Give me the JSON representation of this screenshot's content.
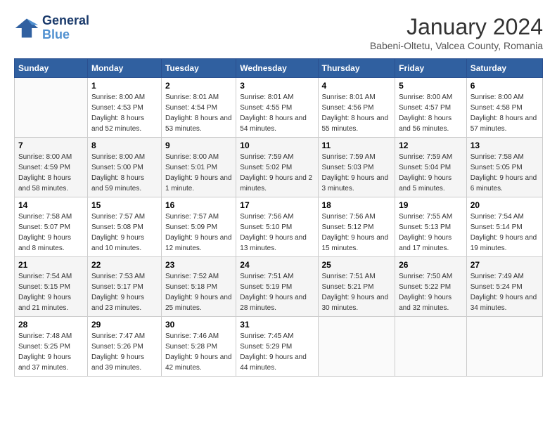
{
  "logo": {
    "line1": "General",
    "line2": "Blue"
  },
  "title": "January 2024",
  "location": "Babeni-Oltetu, Valcea County, Romania",
  "headers": [
    "Sunday",
    "Monday",
    "Tuesday",
    "Wednesday",
    "Thursday",
    "Friday",
    "Saturday"
  ],
  "weeks": [
    [
      {
        "day": "",
        "sunrise": "",
        "sunset": "",
        "daylight": ""
      },
      {
        "day": "1",
        "sunrise": "Sunrise: 8:00 AM",
        "sunset": "Sunset: 4:53 PM",
        "daylight": "Daylight: 8 hours and 52 minutes."
      },
      {
        "day": "2",
        "sunrise": "Sunrise: 8:01 AM",
        "sunset": "Sunset: 4:54 PM",
        "daylight": "Daylight: 8 hours and 53 minutes."
      },
      {
        "day": "3",
        "sunrise": "Sunrise: 8:01 AM",
        "sunset": "Sunset: 4:55 PM",
        "daylight": "Daylight: 8 hours and 54 minutes."
      },
      {
        "day": "4",
        "sunrise": "Sunrise: 8:01 AM",
        "sunset": "Sunset: 4:56 PM",
        "daylight": "Daylight: 8 hours and 55 minutes."
      },
      {
        "day": "5",
        "sunrise": "Sunrise: 8:00 AM",
        "sunset": "Sunset: 4:57 PM",
        "daylight": "Daylight: 8 hours and 56 minutes."
      },
      {
        "day": "6",
        "sunrise": "Sunrise: 8:00 AM",
        "sunset": "Sunset: 4:58 PM",
        "daylight": "Daylight: 8 hours and 57 minutes."
      }
    ],
    [
      {
        "day": "7",
        "sunrise": "Sunrise: 8:00 AM",
        "sunset": "Sunset: 4:59 PM",
        "daylight": "Daylight: 8 hours and 58 minutes."
      },
      {
        "day": "8",
        "sunrise": "Sunrise: 8:00 AM",
        "sunset": "Sunset: 5:00 PM",
        "daylight": "Daylight: 8 hours and 59 minutes."
      },
      {
        "day": "9",
        "sunrise": "Sunrise: 8:00 AM",
        "sunset": "Sunset: 5:01 PM",
        "daylight": "Daylight: 9 hours and 1 minute."
      },
      {
        "day": "10",
        "sunrise": "Sunrise: 7:59 AM",
        "sunset": "Sunset: 5:02 PM",
        "daylight": "Daylight: 9 hours and 2 minutes."
      },
      {
        "day": "11",
        "sunrise": "Sunrise: 7:59 AM",
        "sunset": "Sunset: 5:03 PM",
        "daylight": "Daylight: 9 hours and 3 minutes."
      },
      {
        "day": "12",
        "sunrise": "Sunrise: 7:59 AM",
        "sunset": "Sunset: 5:04 PM",
        "daylight": "Daylight: 9 hours and 5 minutes."
      },
      {
        "day": "13",
        "sunrise": "Sunrise: 7:58 AM",
        "sunset": "Sunset: 5:05 PM",
        "daylight": "Daylight: 9 hours and 6 minutes."
      }
    ],
    [
      {
        "day": "14",
        "sunrise": "Sunrise: 7:58 AM",
        "sunset": "Sunset: 5:07 PM",
        "daylight": "Daylight: 9 hours and 8 minutes."
      },
      {
        "day": "15",
        "sunrise": "Sunrise: 7:57 AM",
        "sunset": "Sunset: 5:08 PM",
        "daylight": "Daylight: 9 hours and 10 minutes."
      },
      {
        "day": "16",
        "sunrise": "Sunrise: 7:57 AM",
        "sunset": "Sunset: 5:09 PM",
        "daylight": "Daylight: 9 hours and 12 minutes."
      },
      {
        "day": "17",
        "sunrise": "Sunrise: 7:56 AM",
        "sunset": "Sunset: 5:10 PM",
        "daylight": "Daylight: 9 hours and 13 minutes."
      },
      {
        "day": "18",
        "sunrise": "Sunrise: 7:56 AM",
        "sunset": "Sunset: 5:12 PM",
        "daylight": "Daylight: 9 hours and 15 minutes."
      },
      {
        "day": "19",
        "sunrise": "Sunrise: 7:55 AM",
        "sunset": "Sunset: 5:13 PM",
        "daylight": "Daylight: 9 hours and 17 minutes."
      },
      {
        "day": "20",
        "sunrise": "Sunrise: 7:54 AM",
        "sunset": "Sunset: 5:14 PM",
        "daylight": "Daylight: 9 hours and 19 minutes."
      }
    ],
    [
      {
        "day": "21",
        "sunrise": "Sunrise: 7:54 AM",
        "sunset": "Sunset: 5:15 PM",
        "daylight": "Daylight: 9 hours and 21 minutes."
      },
      {
        "day": "22",
        "sunrise": "Sunrise: 7:53 AM",
        "sunset": "Sunset: 5:17 PM",
        "daylight": "Daylight: 9 hours and 23 minutes."
      },
      {
        "day": "23",
        "sunrise": "Sunrise: 7:52 AM",
        "sunset": "Sunset: 5:18 PM",
        "daylight": "Daylight: 9 hours and 25 minutes."
      },
      {
        "day": "24",
        "sunrise": "Sunrise: 7:51 AM",
        "sunset": "Sunset: 5:19 PM",
        "daylight": "Daylight: 9 hours and 28 minutes."
      },
      {
        "day": "25",
        "sunrise": "Sunrise: 7:51 AM",
        "sunset": "Sunset: 5:21 PM",
        "daylight": "Daylight: 9 hours and 30 minutes."
      },
      {
        "day": "26",
        "sunrise": "Sunrise: 7:50 AM",
        "sunset": "Sunset: 5:22 PM",
        "daylight": "Daylight: 9 hours and 32 minutes."
      },
      {
        "day": "27",
        "sunrise": "Sunrise: 7:49 AM",
        "sunset": "Sunset: 5:24 PM",
        "daylight": "Daylight: 9 hours and 34 minutes."
      }
    ],
    [
      {
        "day": "28",
        "sunrise": "Sunrise: 7:48 AM",
        "sunset": "Sunset: 5:25 PM",
        "daylight": "Daylight: 9 hours and 37 minutes."
      },
      {
        "day": "29",
        "sunrise": "Sunrise: 7:47 AM",
        "sunset": "Sunset: 5:26 PM",
        "daylight": "Daylight: 9 hours and 39 minutes."
      },
      {
        "day": "30",
        "sunrise": "Sunrise: 7:46 AM",
        "sunset": "Sunset: 5:28 PM",
        "daylight": "Daylight: 9 hours and 42 minutes."
      },
      {
        "day": "31",
        "sunrise": "Sunrise: 7:45 AM",
        "sunset": "Sunset: 5:29 PM",
        "daylight": "Daylight: 9 hours and 44 minutes."
      },
      {
        "day": "",
        "sunrise": "",
        "sunset": "",
        "daylight": ""
      },
      {
        "day": "",
        "sunrise": "",
        "sunset": "",
        "daylight": ""
      },
      {
        "day": "",
        "sunrise": "",
        "sunset": "",
        "daylight": ""
      }
    ]
  ]
}
